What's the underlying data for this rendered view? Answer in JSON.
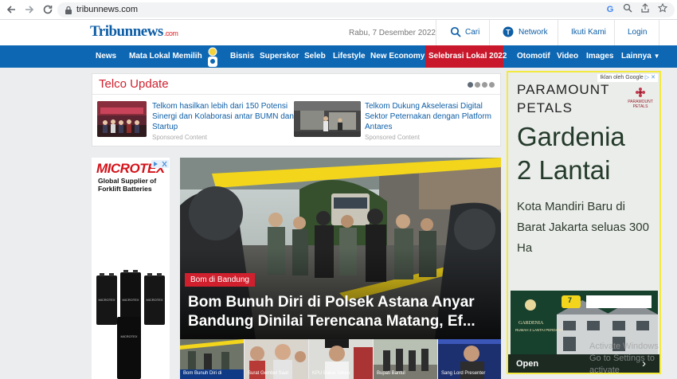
{
  "browser": {
    "url": "tribunnews.com",
    "back_icon": "arrow-left-icon",
    "forward_icon": "arrow-right-icon",
    "reload_icon": "reload-icon"
  },
  "header": {
    "logo_main": "Tribun",
    "logo_news": "news",
    "logo_suffix": ".com",
    "date": "Rabu, 7 Desember 2022",
    "search_label": "Cari",
    "network_label": "Network",
    "follow_label": "Ikuti Kami",
    "login_label": "Login"
  },
  "nav": {
    "items": [
      "News",
      "Mata Lokal Memilih",
      "Bisnis",
      "Superskor",
      "Seleb",
      "Lifestyle",
      "New Economy",
      "Selebrasi Lokal 2022",
      "Otomotif",
      "Video",
      "Images",
      "Lainnya"
    ],
    "highlight_color": "#c9182b",
    "bar_color": "#0d67b3"
  },
  "telco": {
    "title": "Telco Update",
    "articles": [
      {
        "headline": "Telkom hasilkan lebih dari 150 Potensi Sinergi dan Kolaborasi antar BUMN dan Startup",
        "sponsor": "Sponsored Content"
      },
      {
        "headline": "Telkom Dukung Akselerasi Digital Sektor Peternakan dengan Platform Antares",
        "sponsor": "Sponsored Content"
      }
    ]
  },
  "left_ad": {
    "brand": "MICROTEX",
    "tagline_1": "Global Supplier of",
    "tagline_2": "Forklift Batteries",
    "battery_label": "MICROTEX"
  },
  "hero": {
    "tag": "Bom di Bandung",
    "headline": "Bom Bunuh Diri di Polsek Astana Anyar Bandung Dinilai Terencana Matang, Ef...",
    "tag_color": "#d0202e"
  },
  "strip": {
    "captions": [
      "Bom Bunuh Diri di",
      "Surat Gembel Saat",
      "KPU Bakal Tahan",
      "Bupati Bantul",
      "Sang Lord Presenter"
    ]
  },
  "right_ad": {
    "ad_label": "Iklan oleh Google",
    "brand_line_1": "PARAMOUNT",
    "brand_line_2": "PETALS",
    "mini_logo": "PARAMOUNT PETALS",
    "headline_1": "Gardenia",
    "headline_2": "2 Lantai",
    "subtext": "Kota Mandiri Baru di Barat Jakarta seluas 300 Ha",
    "banner_title": "GARDENIA",
    "banner_sub": "RUMAH 2 LANTAI PERDANA",
    "banner_price": "7",
    "open_label": "Open",
    "border_color": "#f2ea3e"
  },
  "windows": {
    "line_1": "Activate Windows",
    "line_2": "Go to Settings to activate"
  }
}
